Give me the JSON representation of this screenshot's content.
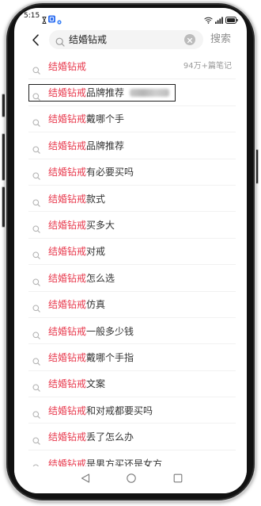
{
  "status_bar": {
    "time": "5:15"
  },
  "search": {
    "query": "结婚钻戒",
    "submit_label": "搜索"
  },
  "suggestions": [
    {
      "highlight": "结婚钻戒",
      "meta": "94万+篇笔记"
    },
    {
      "highlight": "结婚钻戒",
      "rest": "品牌推荐"
    },
    {
      "highlight": "结婚钻戒",
      "rest": "戴哪个手"
    },
    {
      "highlight": "结婚钻戒",
      "rest": "品牌推荐"
    },
    {
      "highlight": "结婚钻戒",
      "rest": "有必要买吗"
    },
    {
      "highlight": "结婚钻戒",
      "rest": "款式"
    },
    {
      "highlight": "结婚钻戒",
      "rest": "买多大"
    },
    {
      "highlight": "结婚钻戒",
      "rest": "对戒"
    },
    {
      "highlight": "结婚钻戒",
      "rest": "怎么选"
    },
    {
      "highlight": "结婚钻戒",
      "rest": "仿真"
    },
    {
      "highlight": "结婚钻戒",
      "rest": "一般多少钱"
    },
    {
      "highlight": "结婚钻戒",
      "rest": "戴哪个手指"
    },
    {
      "highlight": "结婚钻戒",
      "rest": "文案"
    },
    {
      "highlight": "结婚钻戒",
      "rest": "和对戒都要买吗"
    },
    {
      "highlight": "结婚钻戒",
      "rest": "丢了怎么办"
    },
    {
      "highlight": "结婚钻戒",
      "rest": "是男方买还是女方"
    }
  ],
  "icons": {
    "back": "chevron-left-icon",
    "search": "search-icon",
    "clear": "clear-icon",
    "status": [
      "hourglass-icon",
      "app-notification-icon",
      "settings-dot-icon",
      "wifi-icon",
      "signal-icon",
      "battery-icon"
    ],
    "nav": [
      "nav-back-icon",
      "nav-home-icon",
      "nav-recents-icon"
    ]
  },
  "colors": {
    "accent": "#e8394d",
    "text": "#333333",
    "muted": "#9a9a9a",
    "divider": "#f1f1f1",
    "input_bg": "#f4f4f4"
  }
}
